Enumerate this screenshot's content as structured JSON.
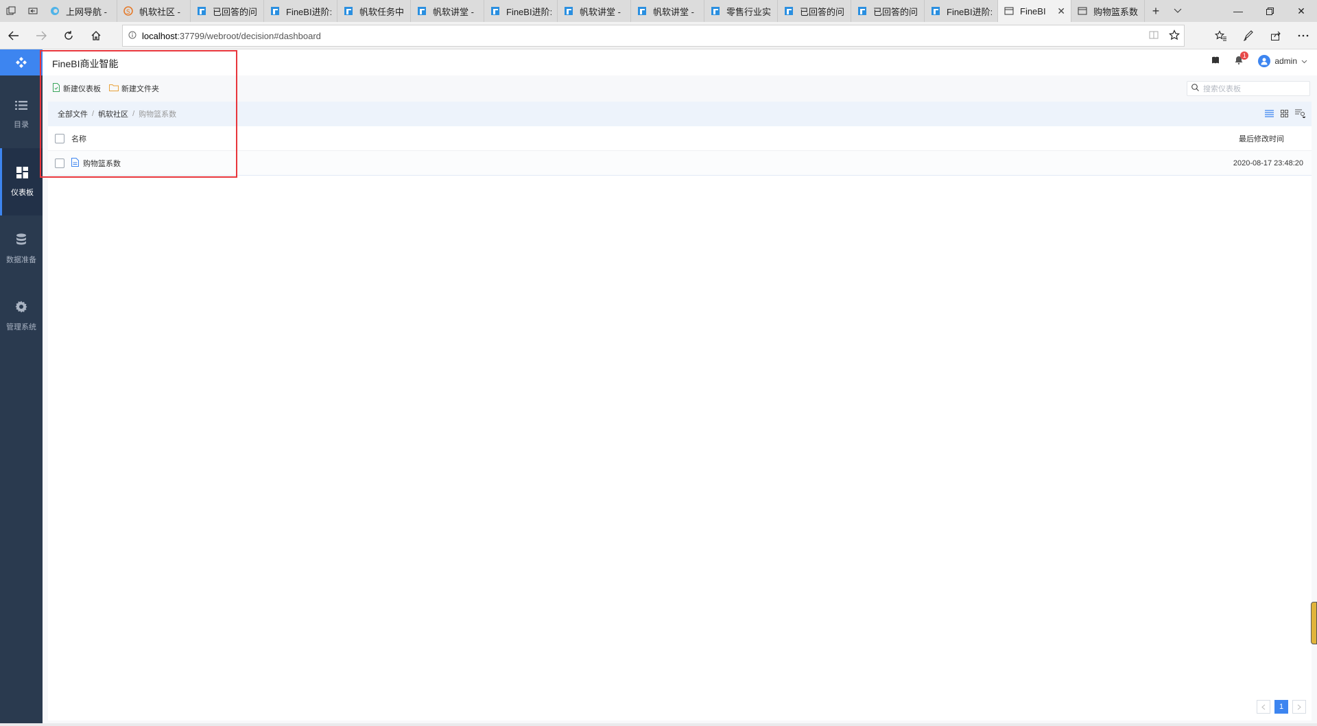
{
  "browser": {
    "tabs": [
      {
        "label": "上网导航 -",
        "icon": "edge-nav-icon"
      },
      {
        "label": "帆软社区 -",
        "icon": "fanruan-s-icon"
      },
      {
        "label": "已回答的问",
        "icon": "finebi-icon"
      },
      {
        "label": "FineBI进阶:",
        "icon": "finebi-icon"
      },
      {
        "label": "帆软任务中",
        "icon": "finebi-icon"
      },
      {
        "label": "帆软讲堂 -",
        "icon": "finebi-icon"
      },
      {
        "label": "FineBI进阶:",
        "icon": "finebi-icon"
      },
      {
        "label": "帆软讲堂 -",
        "icon": "finebi-icon"
      },
      {
        "label": "帆软讲堂 -",
        "icon": "finebi-icon"
      },
      {
        "label": "零售行业实",
        "icon": "finebi-icon"
      },
      {
        "label": "已回答的问",
        "icon": "finebi-icon"
      },
      {
        "label": "已回答的问",
        "icon": "finebi-icon"
      },
      {
        "label": "FineBI进阶:",
        "icon": "finebi-icon"
      },
      {
        "label": "FineBI",
        "icon": "page-icon",
        "active": true
      },
      {
        "label": "购物篮系数",
        "icon": "page-icon"
      }
    ],
    "url_host": "localhost",
    "url_path": ":37799/webroot/decision#dashboard"
  },
  "sidebar": {
    "items": [
      {
        "label": "目录",
        "icon": "list-icon"
      },
      {
        "label": "仪表板",
        "icon": "dashboard-icon",
        "active": true
      },
      {
        "label": "数据准备",
        "icon": "database-icon"
      },
      {
        "label": "管理系统",
        "icon": "gear-icon"
      }
    ]
  },
  "header": {
    "title": "FineBI商业智能",
    "notification_count": "1",
    "username": "admin"
  },
  "toolbar": {
    "new_dashboard": "新建仪表板",
    "new_folder": "新建文件夹",
    "search_placeholder": "搜索仪表板"
  },
  "breadcrumb": {
    "items": [
      "全部文件",
      "帆软社区",
      "购物篮系数"
    ],
    "separator": "/"
  },
  "table": {
    "columns": {
      "name": "名称",
      "modified": "最后修改时间"
    },
    "rows": [
      {
        "name": "购物篮系数",
        "modified": "2020-08-17 23:48:20"
      }
    ]
  },
  "pager": {
    "current": "1"
  },
  "colors": {
    "accent": "#3d85f0",
    "sidebar": "#2a3a4f",
    "highlight": "#e8353b"
  }
}
